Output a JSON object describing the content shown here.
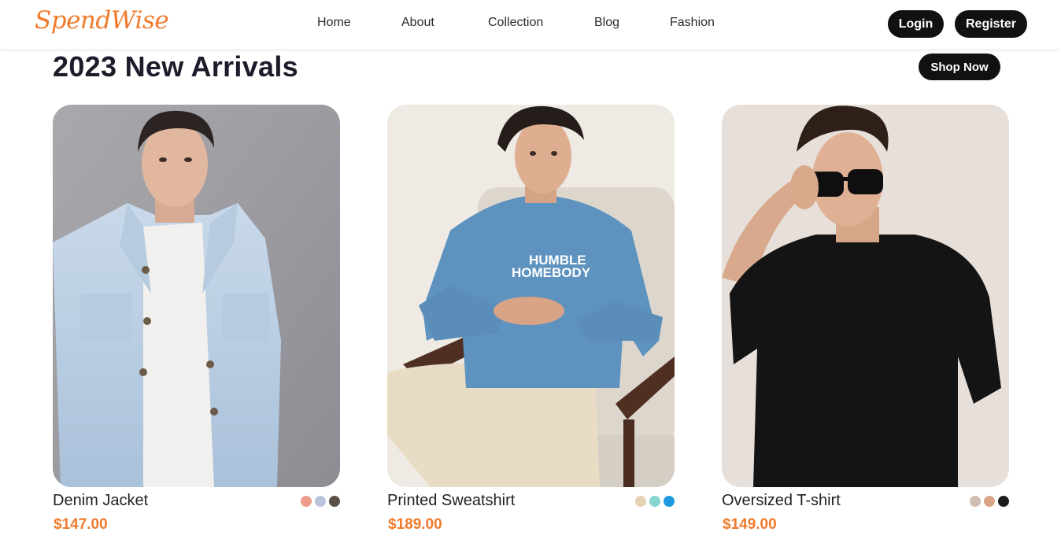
{
  "header": {
    "logo": "SpendWise",
    "nav": [
      "Home",
      "About",
      "Collection",
      "Blog",
      "Fashion"
    ],
    "login_label": "Login",
    "register_label": "Register"
  },
  "section": {
    "title": "2023 New Arrivals",
    "shop_now_label": "Shop Now"
  },
  "products": [
    {
      "name": "Denim Jacket",
      "price": "$147.00",
      "swatches": [
        "#ee9c8c",
        "#b9c4dc",
        "#5a5147"
      ]
    },
    {
      "name": "Printed Sweatshirt",
      "price": "$189.00",
      "swatches": [
        "#e5d2b3",
        "#86d3cf",
        "#1f9ae0"
      ]
    },
    {
      "name": "Oversized T-shirt",
      "price": "$149.00",
      "swatches": [
        "#cfbeb1",
        "#dba487",
        "#1c1c1c"
      ]
    }
  ],
  "print_text": [
    "HUMBLE",
    "HOMEBODY"
  ],
  "colors": {
    "accent": "#f07a2c",
    "dark": "#111111"
  }
}
